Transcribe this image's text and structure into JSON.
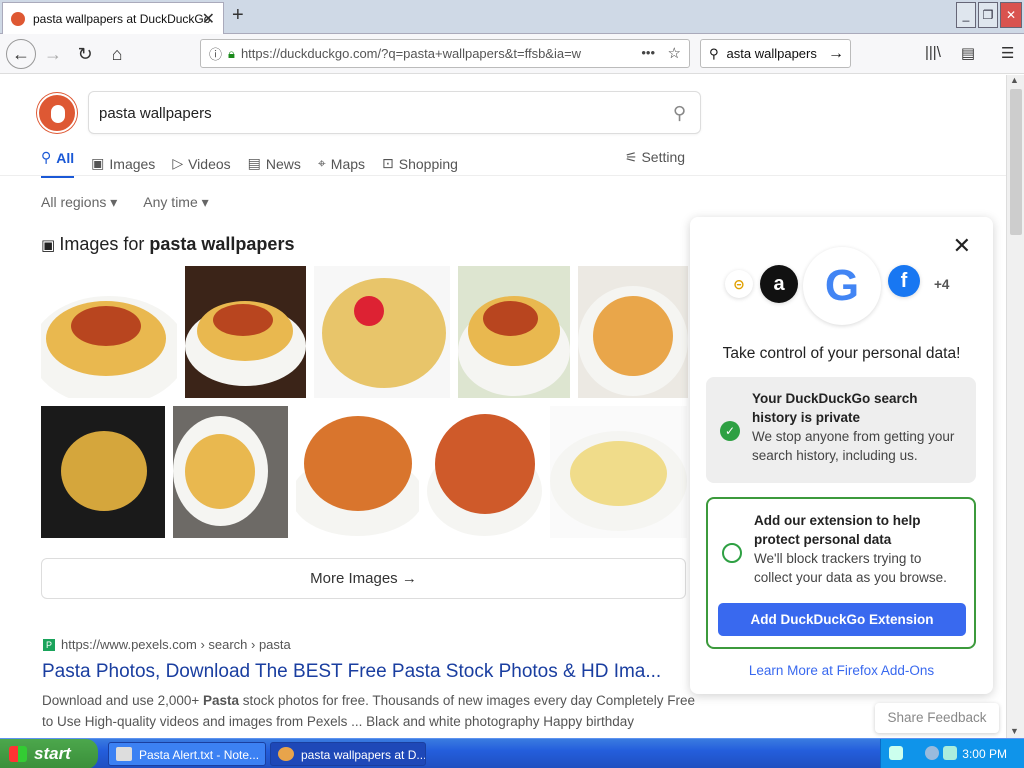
{
  "browser": {
    "tab_title": "pasta wallpapers at DuckDuckGo",
    "tab_close": "✕",
    "new_tab": "+",
    "url": "https://duckduckgo.com/?q=pasta+wallpapers&t=ffsb&ia=w",
    "url_more": "•••",
    "search_value": "asta wallpapers",
    "window_controls": [
      "_",
      "❐",
      "✕"
    ]
  },
  "ddg": {
    "query": "pasta wallpapers",
    "tabs": [
      {
        "label": "All",
        "icon": "search-icon"
      },
      {
        "label": "Images",
        "icon": "image-icon"
      },
      {
        "label": "Videos",
        "icon": "play-icon"
      },
      {
        "label": "News",
        "icon": "news-icon"
      },
      {
        "label": "Maps",
        "icon": "map-pin-icon"
      },
      {
        "label": "Shopping",
        "icon": "bag-icon"
      }
    ],
    "settings_label": "Setting",
    "filters": [
      "All regions ▾",
      "Any time ▾"
    ],
    "images_prefix": "Images for ",
    "images_query": "pasta wallpapers",
    "more_images": "More Images",
    "result": {
      "url": "https://www.pexels.com › search › pasta",
      "favicon": "P",
      "title": "Pasta Photos, Download The BEST Free Pasta Stock Photos & HD Ima...",
      "snippet_a": "Download and use 2,000+ ",
      "snippet_bold": "Pasta",
      "snippet_b": " stock photos for free. Thousands of new images every day Completely Free to Use High-quality videos and images from Pexels ... Black and white photography Happy birthday"
    },
    "share_feedback": "Share Feedback"
  },
  "popup": {
    "more_count": "+4",
    "title": "Take control of your personal data!",
    "card1_title": "Your DuckDuckGo search history is private",
    "card1_text": "We stop anyone from getting your search history, including us.",
    "card2_title": "Add our extension to help protect personal data",
    "card2_text": "We'll block trackers trying to collect your data as you browse.",
    "add_button": "Add DuckDuckGo Extension",
    "learn_more": "Learn More at Firefox Add-Ons",
    "accent_color": "#3969ef"
  },
  "taskbar": {
    "start": "start",
    "items": [
      "Pasta Alert.txt - Note...",
      "pasta wallpapers at D..."
    ],
    "clock": "3:00 PM"
  }
}
